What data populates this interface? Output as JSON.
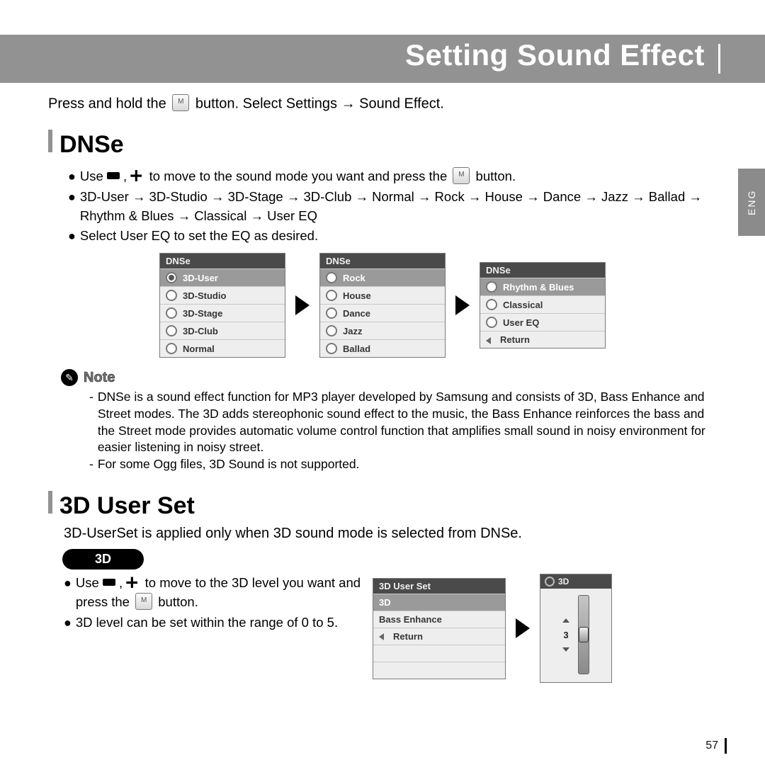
{
  "header": {
    "title": "Setting Sound Effect"
  },
  "side_tab": "ENG",
  "intro": {
    "prefix": "Press and hold the",
    "btn": "M",
    "suffix": "button. Select Settings → Sound Effect."
  },
  "sections": {
    "dnse": {
      "title": "DNSe",
      "bullets": [
        "to move to the sound mode you want and press the",
        "3D-User → 3D-Studio → 3D-Stage → 3D-Club → Normal → Rock → House → Dance → Jazz → Ballad → Rhythm & Blues → Classical → User EQ",
        "Select User EQ to set the EQ as desired."
      ],
      "use_prefix": "Use",
      "button_word": "button.",
      "panels": [
        {
          "title": "DNSe",
          "items": [
            "3D-User",
            "3D-Studio",
            "3D-Stage",
            "3D-Club",
            "Normal"
          ],
          "selected": 0
        },
        {
          "title": "DNSe",
          "items": [
            "Rock",
            "House",
            "Dance",
            "Jazz",
            "Ballad"
          ],
          "selected": 0
        },
        {
          "title": "DNSe",
          "items": [
            "Rhythm & Blues",
            "Classical",
            "User EQ",
            "Return"
          ],
          "selected": 0,
          "return_index": 3
        }
      ]
    },
    "note": {
      "label": "Note",
      "lines": [
        "DNSe is a sound effect function for MP3 player developed by Samsung and consists of 3D, Bass Enhance and Street modes. The 3D adds stereophonic sound effect to the music, the Bass Enhance reinforces the bass and the Street mode provides automatic volume control function that amplifies small sound in noisy environment for easier listening in noisy street.",
        "For some Ogg files, 3D Sound is not supported."
      ]
    },
    "user3d": {
      "title": "3D User Set",
      "desc": "3D-UserSet is applied only when 3D sound mode is selected from DNSe.",
      "pill": "3D",
      "bullets_prefix": "Use",
      "bullet1_mid": "to move to the 3D level you want and press the",
      "bullet1_end": "button.",
      "bullet2": "3D level can be set within the range of 0 to 5.",
      "panel": {
        "title": "3D User Set",
        "items": [
          "3D",
          "Bass Enhance",
          "Return"
        ],
        "selected": 0,
        "return_index": 2
      },
      "slider": {
        "title": "3D",
        "value": "3"
      }
    }
  },
  "page_number": "57"
}
